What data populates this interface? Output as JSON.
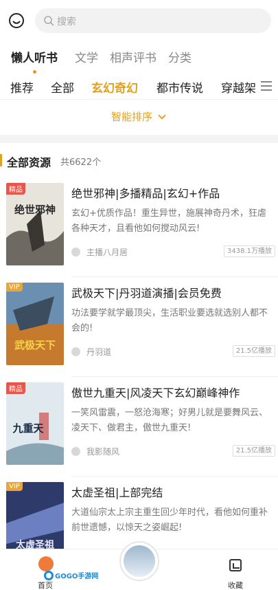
{
  "search": {
    "placeholder": "搜索"
  },
  "main_tabs": [
    {
      "label": "懒人听书",
      "active": true
    },
    {
      "label": "文学",
      "active": false
    },
    {
      "label": "相声评书",
      "active": false
    },
    {
      "label": "分类",
      "active": false
    }
  ],
  "category_tabs": [
    {
      "label": "推荐",
      "active": false
    },
    {
      "label": "全部",
      "active": false
    },
    {
      "label": "玄幻奇幻",
      "active": true
    },
    {
      "label": "都市传说",
      "active": false
    },
    {
      "label": "穿越架",
      "active": false
    }
  ],
  "sort": {
    "label": "智能排序"
  },
  "resources": {
    "title": "全部资源",
    "count": "共6622个"
  },
  "items": [
    {
      "badge": "精品",
      "title": "绝世邪神|多播精品|玄幻+作品",
      "desc": "玄幻+优质作品！重生异世，施展神奇丹术，狂虐各种天才，且看他如何搅动风云!",
      "anchor": "主播八月居",
      "plays": "3438.1万播放",
      "cover_text": "绝世邪神"
    },
    {
      "badge": "VIP",
      "title": "武极天下|丹羽道演播|会员免费",
      "desc": "功法要学就学最顶尖，生活职业要选就选别人都不会的!",
      "anchor": "丹羽道",
      "plays": "21.5亿播放",
      "cover_text": "武极天下"
    },
    {
      "badge": "精品",
      "title": "傲世九重天|风凌天下玄幻巅峰神作",
      "desc": "一笑风雷震，一怒沧海寒；好男儿就是要舞风云、凌天下、做君主，傲世九重天!",
      "anchor": "我影随风",
      "plays": "21.5亿播放",
      "cover_text": "九重天"
    },
    {
      "badge": "VIP",
      "title": "太虚圣祖|上部完结",
      "desc": "大道仙宗太上宗主重生回少年时代，看他如何重补前世遗憾，以惊天之姿崛起!",
      "anchor": "",
      "plays": "",
      "cover_text": "太虚圣祖"
    }
  ],
  "bottom_nav": {
    "home": "首页",
    "favorites": "收藏",
    "watermark": "GOGO手游网"
  },
  "colors": {
    "accent": "#e0a020",
    "badge_jingpin": "#e8554b",
    "badge_vip": "#e9a43a"
  }
}
